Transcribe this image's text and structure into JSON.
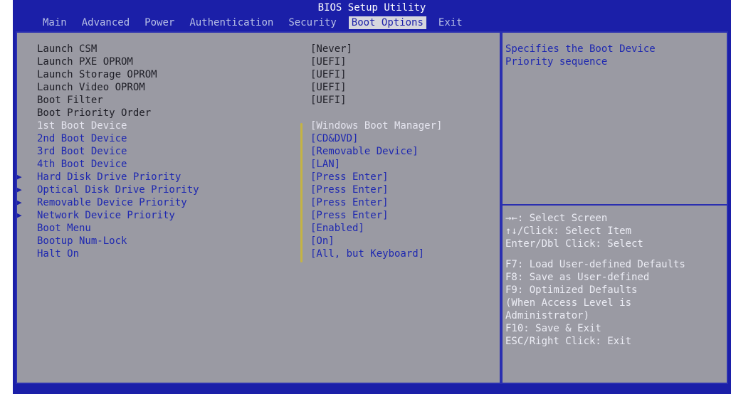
{
  "title": "BIOS Setup Utility",
  "tabs": [
    {
      "label": "Main"
    },
    {
      "label": "Advanced"
    },
    {
      "label": "Power"
    },
    {
      "label": "Authentication"
    },
    {
      "label": "Security"
    },
    {
      "label": "Boot Options"
    },
    {
      "label": "Exit"
    }
  ],
  "active_tab": "Boot Options",
  "options": [
    {
      "label": "Launch CSM",
      "value": "[Never]"
    },
    {
      "label": "Launch PXE OPROM",
      "value": "[UEFI]"
    },
    {
      "label": "Launch Storage OPROM",
      "value": "[UEFI]"
    },
    {
      "label": "Launch Video OPROM",
      "value": "[UEFI]"
    },
    {
      "label": "Boot Filter",
      "value": "[UEFI]"
    },
    {
      "label": "Boot Priority Order",
      "value": ""
    },
    {
      "label": "1st Boot Device",
      "value": "[Windows Boot Manager]"
    },
    {
      "label": "2nd Boot Device",
      "value": "[CD&DVD]"
    },
    {
      "label": "3rd Boot Device",
      "value": "[Removable Device]"
    },
    {
      "label": "4th Boot Device",
      "value": "[LAN]"
    },
    {
      "label": "Hard Disk Drive Priority",
      "value": "[Press Enter]"
    },
    {
      "label": "Optical Disk Drive Priority",
      "value": "[Press Enter]"
    },
    {
      "label": "Removable Device Priority",
      "value": "[Press Enter]"
    },
    {
      "label": "Network Device Priority",
      "value": "[Press Enter]"
    },
    {
      "label": "Boot Menu",
      "value": "[Enabled]"
    },
    {
      "label": "Bootup Num-Lock",
      "value": "[On]"
    },
    {
      "label": "Halt On",
      "value": "[All, but Keyboard]"
    }
  ],
  "help": {
    "description": "Specifies the Boot Device\nPriority sequence",
    "keys": [
      "→←: Select Screen",
      "↑↓/Click: Select Item",
      "Enter/Dbl Click: Select",
      "F7: Load User-defined Defaults",
      "F8: Save as User-defined",
      "F9: Optimized Defaults",
      "(When Access Level is",
      "Administrator)",
      "F10: Save & Exit",
      "ESC/Right Click: Exit"
    ]
  },
  "icons": {
    "submenu_arrow": "triangle-right-icon"
  },
  "colors": {
    "background_blue": "#1b1fa8",
    "panel_gray": "#9a9aa3",
    "link_blue": "#1e28b0",
    "highlight_white": "#e4e4ee",
    "indicator_yellow": "#cdb833"
  }
}
